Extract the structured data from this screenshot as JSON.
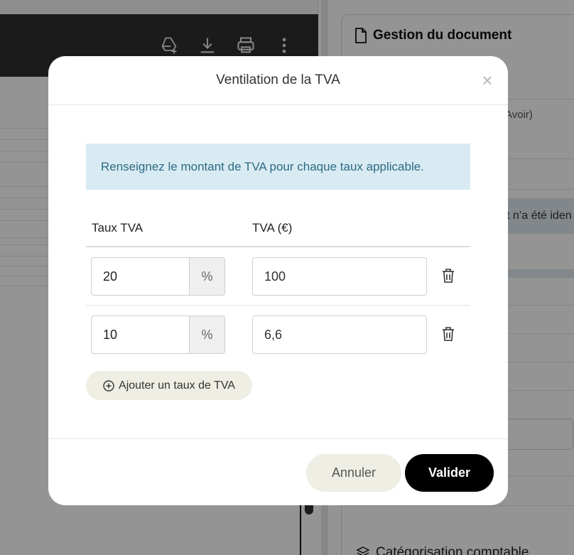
{
  "background": {
    "side_panel": {
      "title": "Gestion du document",
      "partial_text_1": "Avoir)",
      "partial_text_2": "t n’a été iden",
      "footer": "Catégorisation comptable"
    }
  },
  "modal": {
    "title": "Ventilation de la TVA",
    "close_label": "×",
    "info": "Renseignez le montant de TVA pour chaque taux applicable.",
    "table": {
      "header_rate": "Taux TVA",
      "header_vat": "TVA (€)",
      "rows": [
        {
          "rate": "20",
          "suffix": "%",
          "vat": "100"
        },
        {
          "rate": "10",
          "suffix": "%",
          "vat": "6,6"
        }
      ]
    },
    "add_button": "Ajouter un taux de TVA",
    "cancel_button": "Annuler",
    "submit_button": "Valider"
  },
  "icons": {
    "toolbar": [
      "drive-add-icon",
      "download-icon",
      "print-icon",
      "more-vertical-icon"
    ],
    "row_action": "trash-icon",
    "add": "plus-circle-icon"
  },
  "colors": {
    "info_bg": "#d9ebf2",
    "info_text": "#2d6a84",
    "submit_bg": "#000000",
    "secondary_bg": "#efeee4"
  }
}
